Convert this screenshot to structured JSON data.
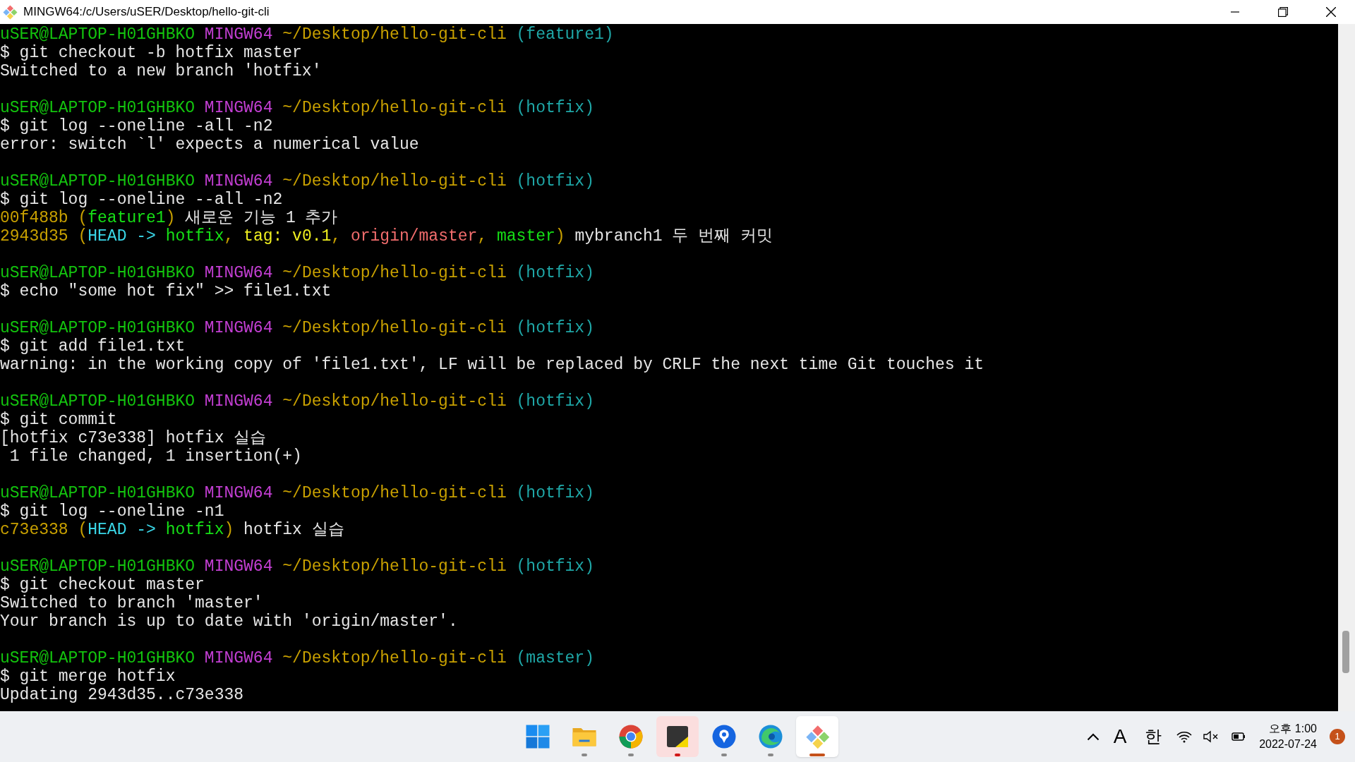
{
  "window": {
    "title": "MINGW64:/c/Users/uSER/Desktop/hello-git-cli"
  },
  "terminal": {
    "blocks": [
      {
        "lines": [
          {
            "segments": [
              {
                "text": "uSER@LAPTOP-H01GHBKO ",
                "kind": "user"
              },
              {
                "text": "MINGW64 ",
                "kind": "host"
              },
              {
                "text": "~/Desktop/hello-git-cli ",
                "kind": "path"
              },
              {
                "text": "(feature1)",
                "kind": "branch"
              }
            ]
          },
          {
            "segments": [
              {
                "text": "$ git checkout -b hotfix master",
                "kind": "text"
              }
            ]
          },
          {
            "segments": [
              {
                "text": "Switched to a new branch 'hotfix'",
                "kind": "text"
              }
            ]
          }
        ]
      },
      {
        "lines": [
          {
            "segments": [
              {
                "text": "uSER@LAPTOP-H01GHBKO ",
                "kind": "user"
              },
              {
                "text": "MINGW64 ",
                "kind": "host"
              },
              {
                "text": "~/Desktop/hello-git-cli ",
                "kind": "path"
              },
              {
                "text": "(hotfix)",
                "kind": "branch"
              }
            ]
          },
          {
            "segments": [
              {
                "text": "$ git log --oneline -all -n2",
                "kind": "text"
              }
            ]
          },
          {
            "segments": [
              {
                "text": "error: switch `l' expects a numerical value",
                "kind": "text"
              }
            ]
          }
        ]
      },
      {
        "lines": [
          {
            "segments": [
              {
                "text": "uSER@LAPTOP-H01GHBKO ",
                "kind": "user"
              },
              {
                "text": "MINGW64 ",
                "kind": "host"
              },
              {
                "text": "~/Desktop/hello-git-cli ",
                "kind": "path"
              },
              {
                "text": "(hotfix)",
                "kind": "branch"
              }
            ]
          },
          {
            "segments": [
              {
                "text": "$ git log --oneline --all -n2",
                "kind": "text"
              }
            ]
          },
          {
            "segments": [
              {
                "text": "00f488b (",
                "kind": "hash"
              },
              {
                "text": "feature1",
                "kind": "local"
              },
              {
                "text": ")",
                "kind": "hash"
              },
              {
                "text": " 새로운 기능 1 추가",
                "kind": "text"
              }
            ]
          },
          {
            "segments": [
              {
                "text": "2943d35 (",
                "kind": "hash"
              },
              {
                "text": "HEAD -> ",
                "kind": "head"
              },
              {
                "text": "hotfix",
                "kind": "local"
              },
              {
                "text": ", ",
                "kind": "hash"
              },
              {
                "text": "tag: v0.1",
                "kind": "tag"
              },
              {
                "text": ", ",
                "kind": "hash"
              },
              {
                "text": "origin/master",
                "kind": "remote"
              },
              {
                "text": ", ",
                "kind": "hash"
              },
              {
                "text": "master",
                "kind": "local"
              },
              {
                "text": ")",
                "kind": "hash"
              },
              {
                "text": " mybranch1 두 번째 커밋",
                "kind": "text"
              }
            ]
          }
        ]
      },
      {
        "lines": [
          {
            "segments": [
              {
                "text": "uSER@LAPTOP-H01GHBKO ",
                "kind": "user"
              },
              {
                "text": "MINGW64 ",
                "kind": "host"
              },
              {
                "text": "~/Desktop/hello-git-cli ",
                "kind": "path"
              },
              {
                "text": "(hotfix)",
                "kind": "branch"
              }
            ]
          },
          {
            "segments": [
              {
                "text": "$ echo \"some hot fix\" >> file1.txt",
                "kind": "text"
              }
            ]
          }
        ]
      },
      {
        "lines": [
          {
            "segments": [
              {
                "text": "uSER@LAPTOP-H01GHBKO ",
                "kind": "user"
              },
              {
                "text": "MINGW64 ",
                "kind": "host"
              },
              {
                "text": "~/Desktop/hello-git-cli ",
                "kind": "path"
              },
              {
                "text": "(hotfix)",
                "kind": "branch"
              }
            ]
          },
          {
            "segments": [
              {
                "text": "$ git add file1.txt",
                "kind": "text"
              }
            ]
          },
          {
            "segments": [
              {
                "text": "warning: in the working copy of 'file1.txt', LF will be replaced by CRLF the next time Git touches it",
                "kind": "text"
              }
            ]
          }
        ]
      },
      {
        "lines": [
          {
            "segments": [
              {
                "text": "uSER@LAPTOP-H01GHBKO ",
                "kind": "user"
              },
              {
                "text": "MINGW64 ",
                "kind": "host"
              },
              {
                "text": "~/Desktop/hello-git-cli ",
                "kind": "path"
              },
              {
                "text": "(hotfix)",
                "kind": "branch"
              }
            ]
          },
          {
            "segments": [
              {
                "text": "$ git commit",
                "kind": "text"
              }
            ]
          },
          {
            "segments": [
              {
                "text": "[hotfix c73e338] hotfix 실습",
                "kind": "text"
              }
            ]
          },
          {
            "segments": [
              {
                "text": " 1 file changed, 1 insertion(+)",
                "kind": "text"
              }
            ]
          }
        ]
      },
      {
        "lines": [
          {
            "segments": [
              {
                "text": "uSER@LAPTOP-H01GHBKO ",
                "kind": "user"
              },
              {
                "text": "MINGW64 ",
                "kind": "host"
              },
              {
                "text": "~/Desktop/hello-git-cli ",
                "kind": "path"
              },
              {
                "text": "(hotfix)",
                "kind": "branch"
              }
            ]
          },
          {
            "segments": [
              {
                "text": "$ git log --oneline -n1",
                "kind": "text"
              }
            ]
          },
          {
            "segments": [
              {
                "text": "c73e338 (",
                "kind": "hash"
              },
              {
                "text": "HEAD -> ",
                "kind": "head"
              },
              {
                "text": "hotfix",
                "kind": "local"
              },
              {
                "text": ")",
                "kind": "hash"
              },
              {
                "text": " hotfix 실습",
                "kind": "text"
              }
            ]
          }
        ]
      },
      {
        "lines": [
          {
            "segments": [
              {
                "text": "uSER@LAPTOP-H01GHBKO ",
                "kind": "user"
              },
              {
                "text": "MINGW64 ",
                "kind": "host"
              },
              {
                "text": "~/Desktop/hello-git-cli ",
                "kind": "path"
              },
              {
                "text": "(hotfix)",
                "kind": "branch"
              }
            ]
          },
          {
            "segments": [
              {
                "text": "$ git checkout master",
                "kind": "text"
              }
            ]
          },
          {
            "segments": [
              {
                "text": "Switched to branch 'master'",
                "kind": "text"
              }
            ]
          },
          {
            "segments": [
              {
                "text": "Your branch is up to date with 'origin/master'.",
                "kind": "text"
              }
            ]
          }
        ]
      },
      {
        "lines": [
          {
            "segments": [
              {
                "text": "uSER@LAPTOP-H01GHBKO ",
                "kind": "user"
              },
              {
                "text": "MINGW64 ",
                "kind": "host"
              },
              {
                "text": "~/Desktop/hello-git-cli ",
                "kind": "path"
              },
              {
                "text": "(master)",
                "kind": "branch"
              }
            ]
          },
          {
            "segments": [
              {
                "text": "$ git merge hotfix",
                "kind": "text"
              }
            ]
          },
          {
            "segments": [
              {
                "text": "Updating 2943d35..c73e338",
                "kind": "text"
              }
            ]
          }
        ]
      }
    ]
  },
  "taskbar": {
    "apps": [
      {
        "kind": "start",
        "running": false,
        "selected": false,
        "flashing": false
      },
      {
        "kind": "folder",
        "running": true,
        "selected": false,
        "flashing": false
      },
      {
        "kind": "chrome",
        "running": true,
        "selected": false,
        "flashing": false
      },
      {
        "kind": "notes",
        "running": true,
        "selected": false,
        "flashing": true
      },
      {
        "kind": "pin",
        "running": true,
        "selected": false,
        "flashing": false
      },
      {
        "kind": "edge",
        "running": true,
        "selected": false,
        "flashing": false
      },
      {
        "kind": "git",
        "running": true,
        "selected": true,
        "flashing": false
      }
    ],
    "tray": {
      "font_glyph": "A",
      "ime": "한",
      "time": "오후 1:00",
      "date": "2022-07-24",
      "notifications": "1"
    }
  }
}
